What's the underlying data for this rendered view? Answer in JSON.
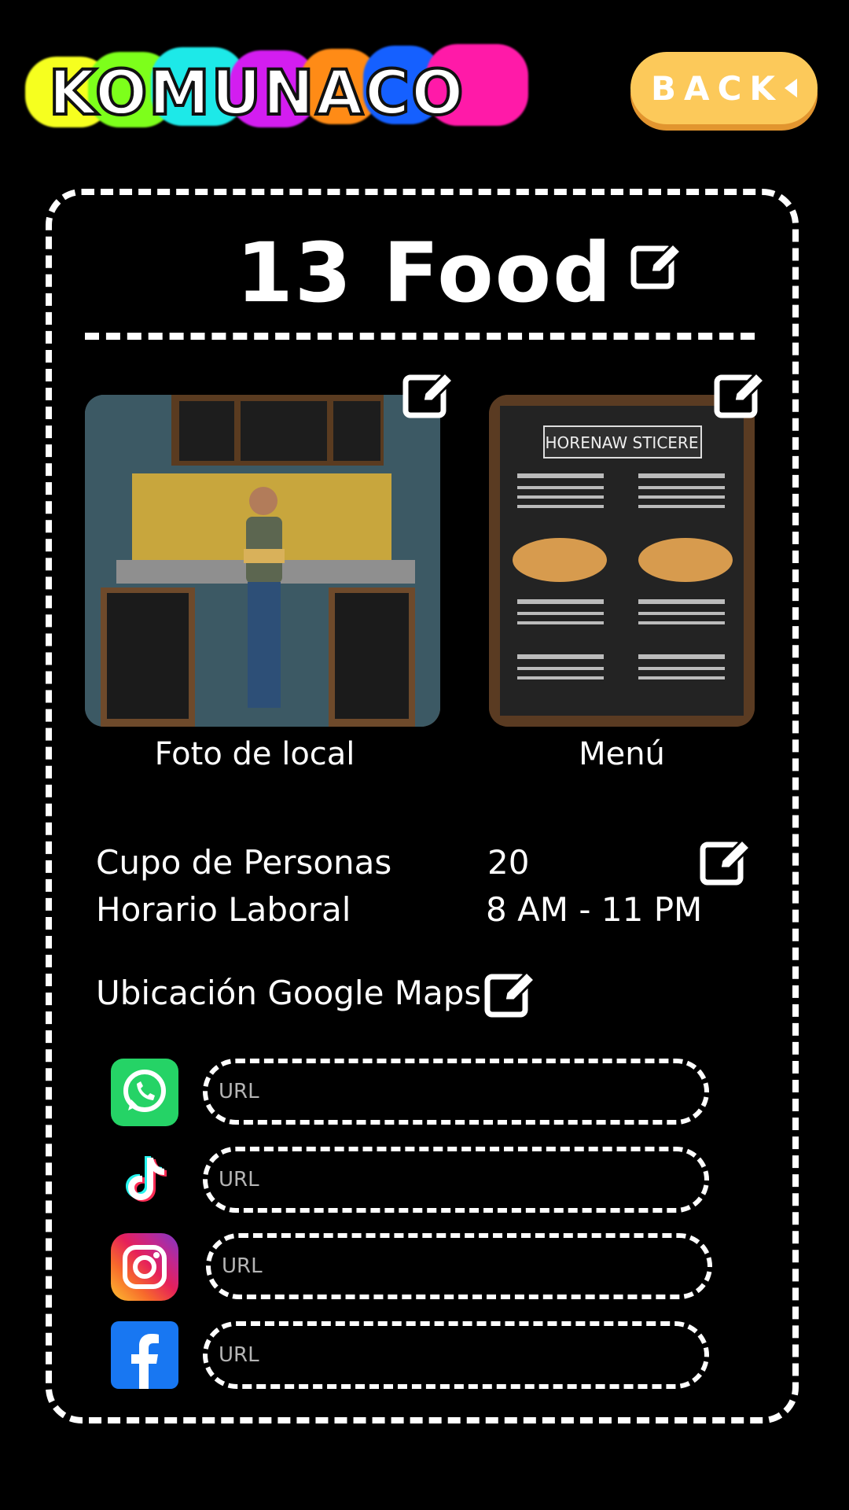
{
  "header": {
    "logo_text": "KOMUNACO",
    "back_label": "BACK"
  },
  "business": {
    "title": "13 Food"
  },
  "photos": {
    "local_caption": "Foto de local",
    "menu_caption": "Menú",
    "menu_board_title": "HORENAW STICERE"
  },
  "info": {
    "capacity_label": "Cupo de Personas",
    "capacity_value": "20",
    "hours_label": "Horario Laboral",
    "hours_value": "8 AM - 11 PM",
    "maps_label": "Ubicación Google Maps"
  },
  "social": [
    {
      "name": "whatsapp",
      "icon": "whatsapp-icon",
      "placeholder": "URL"
    },
    {
      "name": "tiktok",
      "icon": "tiktok-icon",
      "placeholder": "URL"
    },
    {
      "name": "instagram",
      "icon": "instagram-icon",
      "placeholder": "URL"
    },
    {
      "name": "facebook",
      "icon": "facebook-icon",
      "placeholder": "URL"
    }
  ],
  "colors": {
    "background": "#000000",
    "back_button": "#fcc95a",
    "back_button_shadow": "#e2952f",
    "whatsapp": "#25d366",
    "facebook": "#1877f2"
  }
}
